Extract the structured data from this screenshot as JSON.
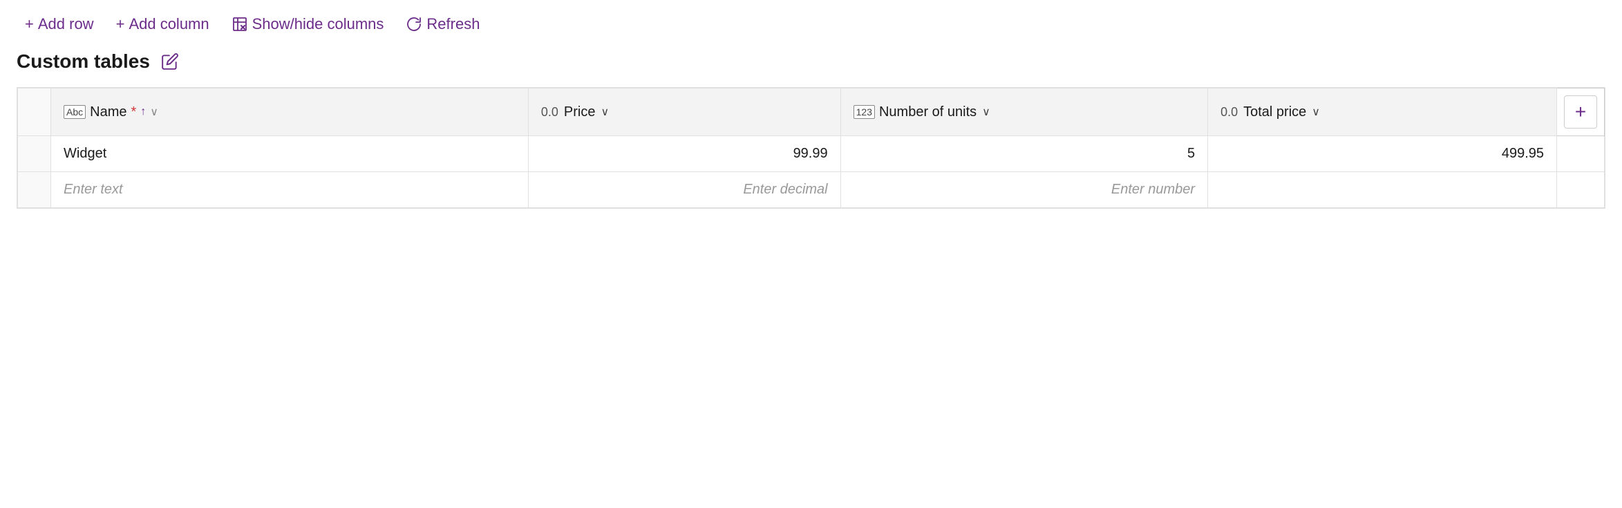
{
  "toolbar": {
    "add_row_label": "Add row",
    "add_column_label": "Add column",
    "show_hide_label": "Show/hide columns",
    "refresh_label": "Refresh"
  },
  "page": {
    "title": "Custom tables"
  },
  "table": {
    "columns": [
      {
        "id": "name",
        "icon": "Abc",
        "icon_type": "text",
        "label": "Name",
        "required": true,
        "sortable": true,
        "type": "text"
      },
      {
        "id": "price",
        "icon": "0.0",
        "icon_type": "decimal",
        "label": "Price",
        "required": false,
        "sortable": false,
        "type": "decimal"
      },
      {
        "id": "units",
        "icon": "123",
        "icon_type": "number",
        "label": "Number of units",
        "required": false,
        "sortable": false,
        "type": "number"
      },
      {
        "id": "total_price",
        "icon": "0.0",
        "icon_type": "decimal",
        "label": "Total price",
        "required": false,
        "sortable": false,
        "type": "decimal"
      }
    ],
    "rows": [
      {
        "name": "Widget",
        "price": "99.99",
        "units": "5",
        "total_price": "499.95"
      }
    ],
    "placeholders": {
      "text": "Enter text",
      "decimal": "Enter decimal",
      "number": "Enter number"
    },
    "add_column_btn_label": "+"
  }
}
